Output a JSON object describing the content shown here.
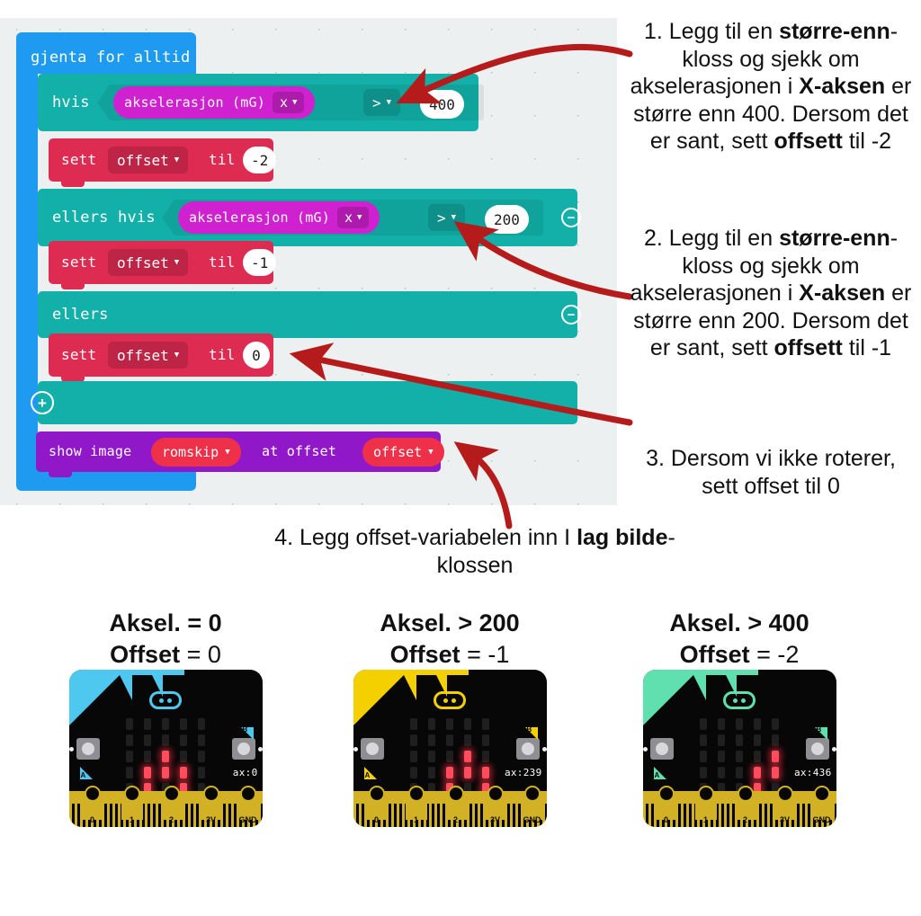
{
  "editor": {
    "forever_label": "gjenta for alltid",
    "if_label": "hvis",
    "elseif_label": "ellers hvis",
    "else_label": "ellers",
    "accel_label_1": "akselerasjon (mG)",
    "accel_axis_1": "x",
    "accel_label_2": "akselerasjon (mG)",
    "accel_axis_2": "x",
    "cmp_1": ">",
    "cmp_2": ">",
    "num_1": "400",
    "num_2": "200",
    "set_label_1": "sett",
    "var_1": "offset",
    "to_label_1": "til",
    "val_1": "-2",
    "set_label_2": "sett",
    "var_2": "offset",
    "to_label_2": "til",
    "val_2": "-1",
    "set_label_3": "sett",
    "var_3": "offset",
    "to_label_3": "til",
    "val_3": "0",
    "show_image_label": "show image",
    "image_name": "romskip",
    "at_offset_label": "at offset",
    "offset_var": "offset",
    "minus_icon": "−",
    "plus_icon": "+",
    "caret": "▼",
    "colors": {
      "forever": "#1e9bf0",
      "logic": "#12b0a8",
      "variable": "#dd2b51",
      "input": "#cf21cf",
      "basic": "#9118c9",
      "canvas": "#ecf0f1"
    }
  },
  "notes": [
    {
      "id": "note-1",
      "segments": [
        {
          "t": "1. Legg til en ",
          "b": false
        },
        {
          "t": "større-enn",
          "b": true
        },
        {
          "t": "-kloss og sjekk om akselerasjonen i ",
          "b": false
        },
        {
          "t": "X-aksen",
          "b": true
        },
        {
          "t": " er større enn 400. Dersom det er sant, sett ",
          "b": false
        },
        {
          "t": "offsett",
          "b": true
        },
        {
          "t": " til -2",
          "b": false
        }
      ]
    },
    {
      "id": "note-2",
      "segments": [
        {
          "t": "2. Legg til en ",
          "b": false
        },
        {
          "t": "større-enn",
          "b": true
        },
        {
          "t": "-kloss og sjekk om akselerasjonen i ",
          "b": false
        },
        {
          "t": "X-aksen",
          "b": true
        },
        {
          "t": " er større enn 200. Dersom det er sant, sett ",
          "b": false
        },
        {
          "t": "offsett",
          "b": true
        },
        {
          "t": " til -1",
          "b": false
        }
      ]
    },
    {
      "id": "note-3",
      "segments": [
        {
          "t": "3. Dersom vi ikke roterer, sett offset til 0",
          "b": false
        }
      ]
    },
    {
      "id": "note-4",
      "segments": [
        {
          "t": "4. Legg offset-variabelen inn I ",
          "b": false
        },
        {
          "t": "lag bilde",
          "b": true
        },
        {
          "t": "-klossen",
          "b": false
        }
      ]
    }
  ],
  "examples": [
    {
      "title": "Aksel. = 0",
      "offset_label": "Offset",
      "offset_value": "= 0",
      "ax_text": "ax:0",
      "accent": "#4ec8ef",
      "leds": [
        [
          0,
          0,
          0,
          0,
          0
        ],
        [
          0,
          0,
          0,
          0,
          0
        ],
        [
          0,
          0,
          1,
          0,
          0
        ],
        [
          0,
          1,
          1,
          1,
          0
        ],
        [
          0,
          1,
          0,
          1,
          0
        ]
      ],
      "pin_labels": [
        "0",
        "1",
        "2",
        "3V",
        "GND"
      ]
    },
    {
      "title": "Aksel. > 200",
      "offset_label": "Offset",
      "offset_value": "= -1",
      "ax_text": "ax:239",
      "accent": "#f5d000",
      "leds": [
        [
          0,
          0,
          0,
          0,
          0
        ],
        [
          0,
          0,
          0,
          0,
          0
        ],
        [
          0,
          0,
          0,
          1,
          0
        ],
        [
          0,
          0,
          1,
          1,
          1
        ],
        [
          0,
          0,
          1,
          0,
          1
        ]
      ],
      "pin_labels": [
        "0",
        "1",
        "2",
        "3V",
        "GND"
      ]
    },
    {
      "title": "Aksel. > 400",
      "offset_label": "Offset",
      "offset_value": "= -2",
      "ax_text": "ax:436",
      "accent": "#5fe0ae",
      "leds": [
        [
          0,
          0,
          0,
          0,
          0
        ],
        [
          0,
          0,
          0,
          0,
          0
        ],
        [
          0,
          0,
          0,
          0,
          1
        ],
        [
          0,
          0,
          0,
          1,
          1
        ],
        [
          0,
          0,
          0,
          1,
          0
        ]
      ],
      "pin_labels": [
        "0",
        "1",
        "2",
        "3V",
        "GND"
      ]
    }
  ]
}
